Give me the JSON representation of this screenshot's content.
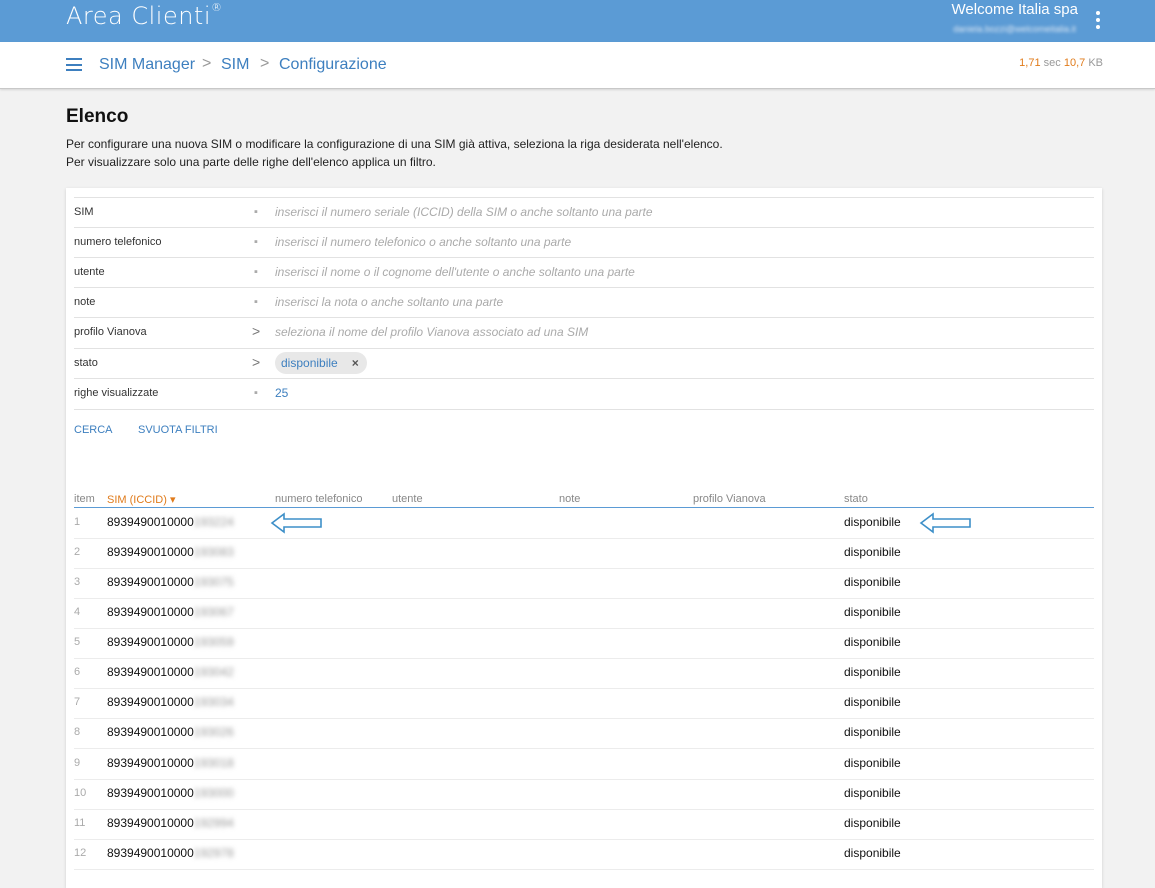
{
  "header": {
    "app_title": "Area Clienti",
    "trademark": "®",
    "company": "Welcome Italia spa",
    "user_email": "daniela.bozzi@welcomeitalia.it"
  },
  "breadcrumb": {
    "items": [
      "SIM Manager",
      "SIM",
      "Configurazione"
    ],
    "separator": ">"
  },
  "timing": {
    "sec_value": "1,71",
    "sec_unit": "sec",
    "kb_value": "10,7",
    "kb_unit": "KB"
  },
  "page": {
    "title": "Elenco",
    "desc1": "Per configurare una nuova SIM o modificare la configurazione di una SIM già attiva, seleziona la riga desiderata nell'elenco.",
    "desc2": "Per visualizzare solo una parte delle righe dell'elenco applica un filtro."
  },
  "filters": [
    {
      "label": "SIM",
      "mark": "▪",
      "placeholder": "inserisci il numero seriale (ICCID) della SIM o anche soltanto una parte"
    },
    {
      "label": "numero telefonico",
      "mark": "▪",
      "placeholder": "inserisci il numero telefonico o anche soltanto una parte"
    },
    {
      "label": "utente",
      "mark": "▪",
      "placeholder": "inserisci il nome o il cognome dell'utente o anche soltanto una parte"
    },
    {
      "label": "note",
      "mark": "▪",
      "placeholder": "inserisci la nota o anche soltanto una parte"
    },
    {
      "label": "profilo Vianova",
      "mark": ">",
      "placeholder": "seleziona il nome del profilo Vianova associato ad una SIM"
    },
    {
      "label": "stato",
      "mark": ">",
      "chip": "disponibile",
      "chip_remove": "×"
    },
    {
      "label": "righe visualizzate",
      "mark": "▪",
      "value": "25"
    }
  ],
  "actions": {
    "search": "CERCA",
    "clear": "SVUOTA FILTRI"
  },
  "table": {
    "headers": {
      "item": "item",
      "sim": "SIM (ICCID) ▾",
      "phone": "numero telefonico",
      "user": "utente",
      "note": "note",
      "profile": "profilo Vianova",
      "status": "stato"
    },
    "rows": [
      {
        "item": "1",
        "sim_prefix": "8939490010000",
        "sim_suffix": "193224",
        "stato": "disponibile"
      },
      {
        "item": "2",
        "sim_prefix": "8939490010000",
        "sim_suffix": "193083",
        "stato": "disponibile"
      },
      {
        "item": "3",
        "sim_prefix": "8939490010000",
        "sim_suffix": "193075",
        "stato": "disponibile"
      },
      {
        "item": "4",
        "sim_prefix": "8939490010000",
        "sim_suffix": "193067",
        "stato": "disponibile"
      },
      {
        "item": "5",
        "sim_prefix": "8939490010000",
        "sim_suffix": "193059",
        "stato": "disponibile"
      },
      {
        "item": "6",
        "sim_prefix": "8939490010000",
        "sim_suffix": "193042",
        "stato": "disponibile"
      },
      {
        "item": "7",
        "sim_prefix": "8939490010000",
        "sim_suffix": "193034",
        "stato": "disponibile"
      },
      {
        "item": "8",
        "sim_prefix": "8939490010000",
        "sim_suffix": "193026",
        "stato": "disponibile"
      },
      {
        "item": "9",
        "sim_prefix": "8939490010000",
        "sim_suffix": "193018",
        "stato": "disponibile"
      },
      {
        "item": "10",
        "sim_prefix": "8939490010000",
        "sim_suffix": "193000",
        "stato": "disponibile"
      },
      {
        "item": "11",
        "sim_prefix": "8939490010000",
        "sim_suffix": "192994",
        "stato": "disponibile"
      },
      {
        "item": "12",
        "sim_prefix": "8939490010000",
        "sim_suffix": "192978",
        "stato": "disponibile"
      }
    ]
  },
  "colors": {
    "accent": "#5b9bd5",
    "link": "#3d7fbf",
    "sort": "#e07b1b"
  }
}
